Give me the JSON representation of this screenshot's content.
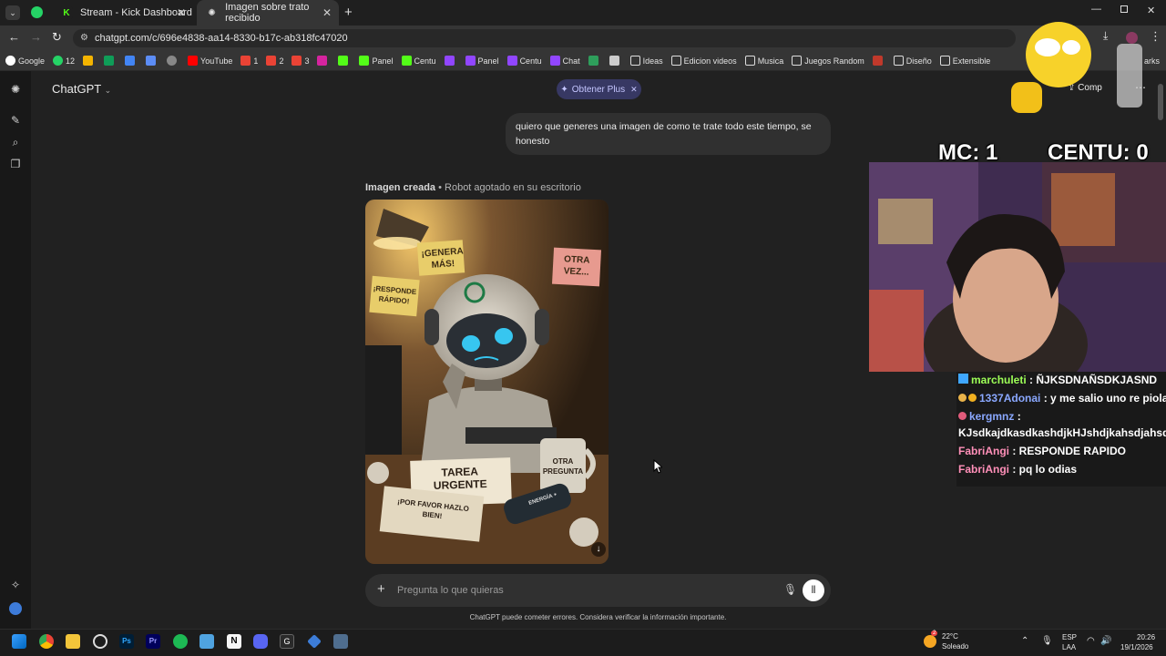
{
  "browser": {
    "tabs": [
      {
        "title": "Stream - Kick Dashboard",
        "active": false
      },
      {
        "title": "Imagen sobre trato recibido",
        "active": true
      }
    ],
    "url": "chatgpt.com/c/696e4838-aa14-8330-b17c-ab318fc47020",
    "bookmarks": [
      "Google",
      "12",
      "YouTube",
      "1",
      "2",
      "3",
      "Panel",
      "Centu",
      "Panel",
      "Centu",
      "Chat",
      "Ideas",
      "Edicion videos",
      "Musica",
      "Juegos Random",
      "Diseño",
      "Extensible"
    ],
    "bookmark_overflow": "arks"
  },
  "chatgpt": {
    "model_label": "ChatGPT",
    "plus_pill": "Obtener Plus",
    "share_label": "Comp",
    "user_message": "quiero que generes una imagen de como te trate todo este tiempo, se honesto",
    "image_caption_bold": "Imagen creada",
    "image_caption_rest": " • Robot agotado en su escritorio",
    "image_notes": {
      "note1": "¡GENERA MÁS!",
      "note2": "OTRA VEZ...",
      "note3": "¡RESPONDE RÁPIDO!",
      "paper1": "TAREA URGENTE",
      "paper2": "¡POR FAVOR HAZLO BIEN!",
      "mug": "OTRA PREGUNTA",
      "can": "ENERGÍA +"
    },
    "composer_placeholder": "Pregunta lo que quieras",
    "disclaimer": "ChatGPT puede cometer errores. Considera verificar la información importante."
  },
  "overlay": {
    "score_left": "MC: 1",
    "score_right": "CENTU: 0"
  },
  "chat": {
    "messages": [
      {
        "user": "marchuleti",
        "color": "#9dff57",
        "text": " : ÑJKSDNAÑSDKJASND"
      },
      {
        "user": "1337Adonai",
        "color": "#8aa8ff",
        "text": " : y me salio uno re piola"
      },
      {
        "user": "kergmnz",
        "color": "#8aa8ff",
        "text": " :"
      },
      {
        "user": "",
        "color": "#ffffff",
        "text": "KJsdkajdkasdkashdjkHJshdjkahsdjahsd"
      },
      {
        "user": "FabriAngi",
        "color": "#ff8fb8",
        "text": " : RESPONDE RAPIDO"
      },
      {
        "user": "FabriAngi",
        "color": "#ff8fb8",
        "text": " : pq lo odias"
      }
    ]
  },
  "taskbar": {
    "weather_temp": "22°C",
    "weather_desc": "Soleado",
    "lang_top": "ESP",
    "lang_bottom": "LAA",
    "time": "20:26",
    "date": "19/1/2026",
    "weather_badge": "2"
  }
}
